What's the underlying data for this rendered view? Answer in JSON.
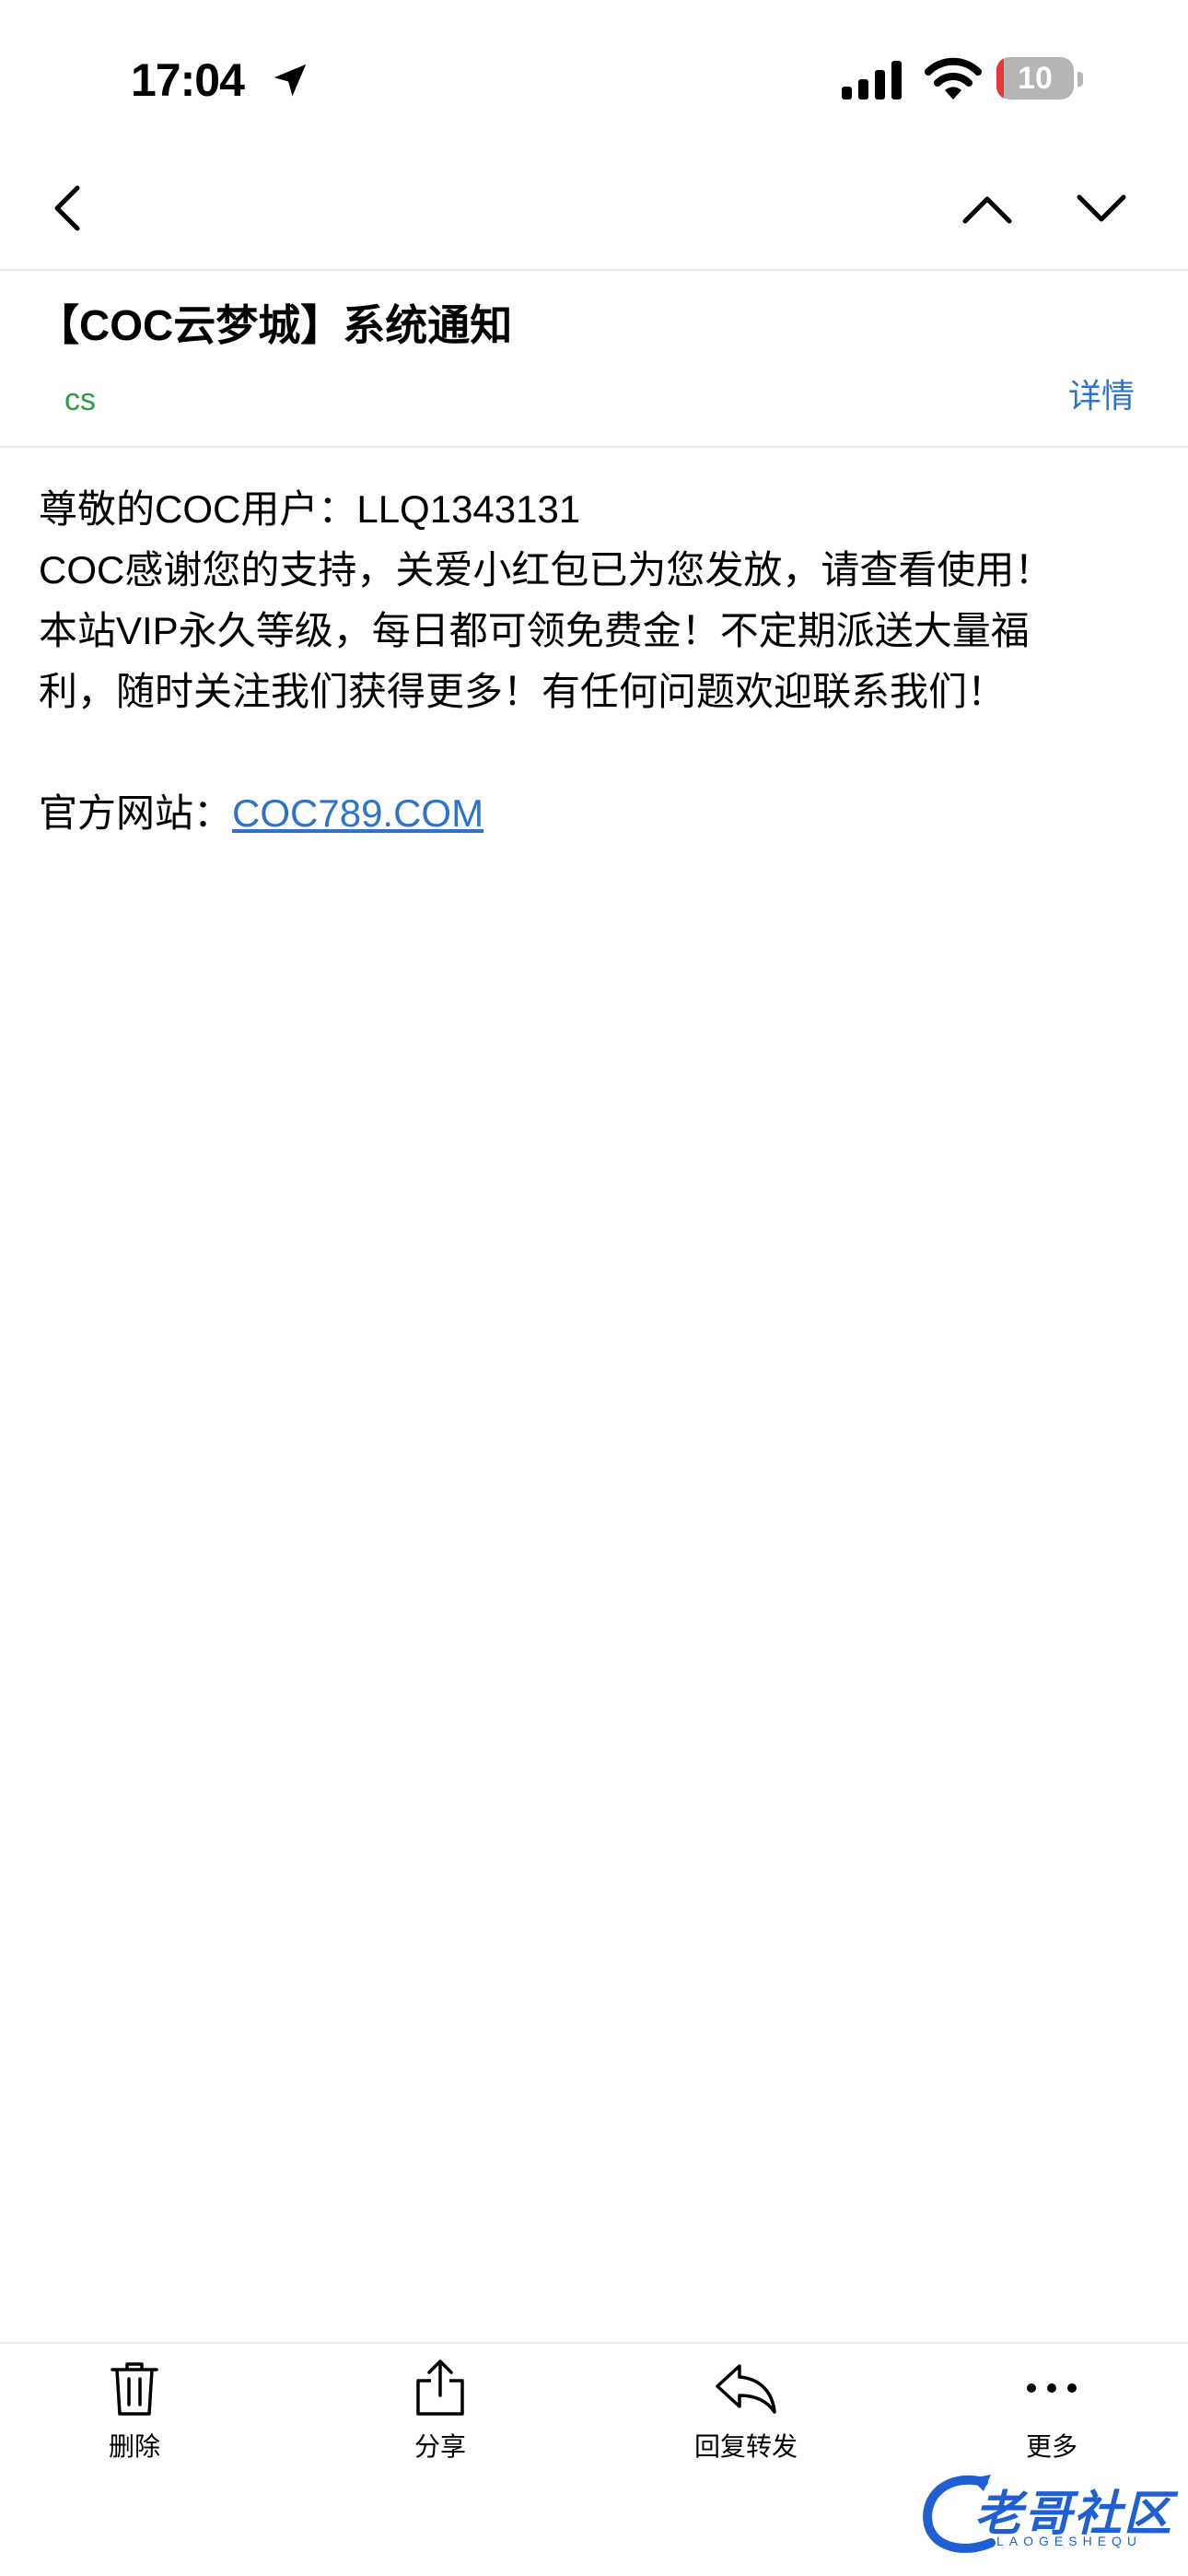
{
  "status_bar": {
    "time": "17:04",
    "battery_level": "10"
  },
  "email": {
    "subject": "【COC云梦城】系统通知",
    "sender": "cs",
    "details_label": "详情",
    "body_lines": [
      "尊敬的COC用户：LLQ1343131",
      "COC感谢您的支持，关爱小红包已为您发放，请查看使用！",
      "本站VIP永久等级，每日都可领免费金！不定期派送大量福",
      "利，随时关注我们获得更多！有任何问题欢迎联系我们！"
    ],
    "site_label": "官方网站：",
    "site_link": "COC789.COM"
  },
  "toolbar": {
    "delete_label": "删除",
    "share_label": "分享",
    "reply_label": "回复转发",
    "more_label": "更多"
  },
  "watermark": {
    "text": "老哥社区",
    "subtext": "LAOGESHEQU"
  },
  "icons": {
    "location": "location-arrow-icon",
    "signal": "cellular-signal-icon",
    "wifi": "wifi-icon",
    "battery": "battery-icon",
    "back": "chevron-left-icon",
    "previous": "chevron-up-icon",
    "next": "chevron-down-icon",
    "delete": "trash-icon",
    "share": "share-icon",
    "reply": "reply-icon",
    "more": "ellipsis-icon"
  },
  "colors": {
    "link": "#2f73c9",
    "sender": "#2c9a46",
    "battery_low": "#e5383b"
  }
}
